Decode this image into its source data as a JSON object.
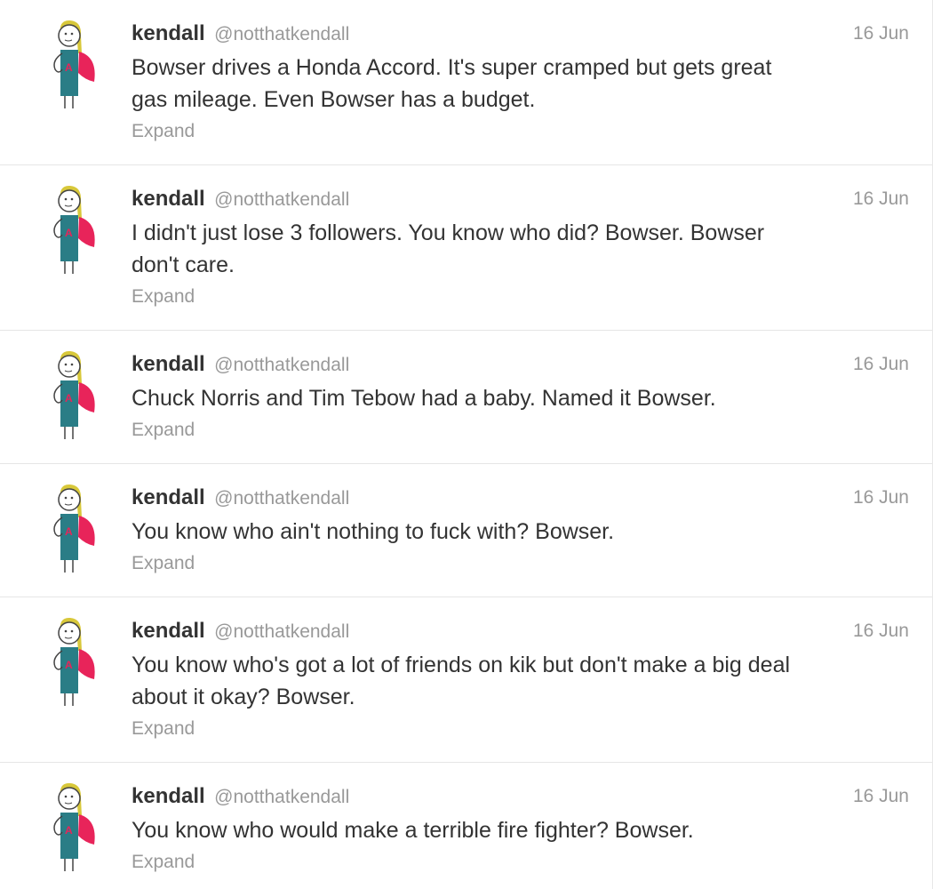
{
  "tweets": [
    {
      "fullname": "kendall",
      "username": "@notthatkendall",
      "time": "16 Jun",
      "text": "Bowser drives a Honda Accord. It's super cramped but gets great\ngas mileage. Even Bowser has a budget.",
      "expand": "Expand"
    },
    {
      "fullname": "kendall",
      "username": "@notthatkendall",
      "time": "16 Jun",
      "text": "I didn't just lose 3 followers. You know who did? Bowser. Bowser\ndon't care.",
      "expand": "Expand"
    },
    {
      "fullname": "kendall",
      "username": "@notthatkendall",
      "time": "16 Jun",
      "text": "Chuck Norris and Tim Tebow had a baby. Named it Bowser.",
      "expand": "Expand"
    },
    {
      "fullname": "kendall",
      "username": "@notthatkendall",
      "time": "16 Jun",
      "text": "You know who ain't nothing to fuck with? Bowser.",
      "expand": "Expand"
    },
    {
      "fullname": "kendall",
      "username": "@notthatkendall",
      "time": "16 Jun",
      "text": "You know who's got a lot of friends on kik but don't make a big deal\nabout it okay? Bowser.",
      "expand": "Expand"
    },
    {
      "fullname": "kendall",
      "username": "@notthatkendall",
      "time": "16 Jun",
      "text": "You know who would make a terrible fire fighter? Bowser.",
      "expand": "Expand"
    }
  ],
  "colors": {
    "name": "#333333",
    "meta": "#999999",
    "divider": "#e6e6e6",
    "avatar_hair": "#d8c83a",
    "avatar_shirt": "#2a7d86",
    "avatar_cape": "#e8245a"
  }
}
